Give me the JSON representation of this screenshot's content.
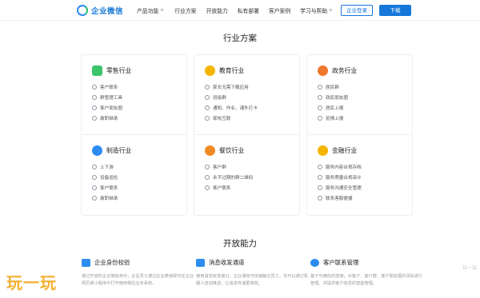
{
  "nav": {
    "logo_text": "企业微信",
    "menu": [
      {
        "label": "产品功能",
        "has_caret": true
      },
      {
        "label": "行业方案",
        "has_caret": false
      },
      {
        "label": "开放能力",
        "has_caret": false
      },
      {
        "label": "私有部署",
        "has_caret": false
      },
      {
        "label": "客户案例",
        "has_caret": false
      },
      {
        "label": "学习与帮助",
        "has_caret": true
      }
    ],
    "login_label": "企业登录",
    "download_label": "下载"
  },
  "solutions": {
    "title": "行业方案",
    "cards": [
      {
        "title": "零售行业",
        "icon": "retail-icon",
        "color": "#3cc46a",
        "items": [
          "客户联系",
          "群管理工具",
          "客户朋友圈",
          "离职继承"
        ]
      },
      {
        "title": "教育行业",
        "icon": "education-icon",
        "color": "#f5b400",
        "items": [
          "家长无需下载应用",
          "班级群",
          "通知、作业、课外打卡",
          "家校互联"
        ]
      },
      {
        "title": "政务行业",
        "icon": "government-icon",
        "color": "#f0772d",
        "items": [
          "居民群",
          "政民朋友圈",
          "居民上报",
          "疫情上报"
        ]
      },
      {
        "title": "制造行业",
        "icon": "manufacturing-icon",
        "color": "#2d8cf0",
        "items": [
          "上下游",
          "设备巡检",
          "客户联系",
          "离职继承"
        ]
      },
      {
        "title": "餐饮行业",
        "icon": "catering-icon",
        "color": "#f08a24",
        "items": [
          "客户群",
          "永不过期的群二维码",
          "客户联系"
        ]
      },
      {
        "title": "金融行业",
        "icon": "finance-icon",
        "color": "#f5b400",
        "items": [
          "服务内容合规存档",
          "服务质量合规审计",
          "服务沟通安全管理",
          "联系客服便捷"
        ]
      }
    ]
  },
  "open": {
    "title": "开放能力",
    "items": [
      {
        "title": "企业身份校验",
        "icon": "identity-icon",
        "color": "#2d8cf0",
        "desc": "通过开放的企业微信身份，企业员工通过企业微信即可在企业网页或小程序中打开使用相应业务系统。"
      },
      {
        "title": "消息收发通道",
        "icon": "message-icon",
        "color": "#2d8cf0",
        "desc": "使用消息收发接口，企业通知可快速触达员工，也可以通过机器人自动推送，让信息传递更高效。"
      },
      {
        "title": "客户联系管理",
        "icon": "customer-icon",
        "color": "#2d8cf0",
        "desc": "基于与微信的连接，对客户、客户群、客户朋友圈的添加进行管理，并提供客户信息的智能管理。"
      }
    ]
  },
  "watermark": {
    "text": "玩一玩",
    "corner": "玩一玩"
  }
}
